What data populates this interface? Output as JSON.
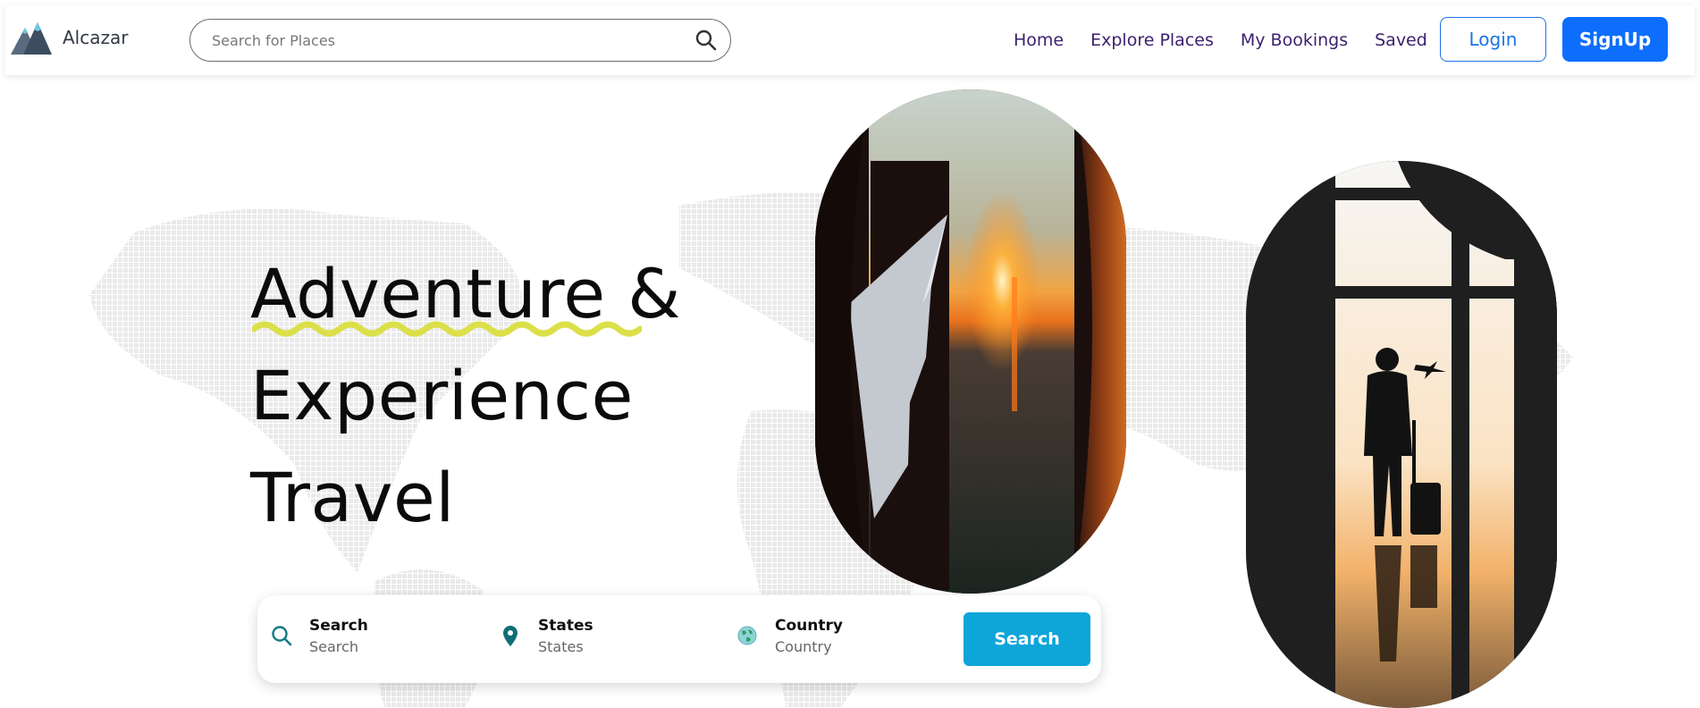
{
  "brand": {
    "name": "Alcazar",
    "logo_icon": "mountain-icon"
  },
  "header_search": {
    "placeholder": "Search for Places",
    "icon": "search-icon"
  },
  "nav": {
    "links": [
      "Home",
      "Explore Places",
      "My Bookings",
      "Saved"
    ],
    "login_label": "Login",
    "signup_label": "SignUp"
  },
  "hero": {
    "title_lines": [
      "Adventure &",
      "Experience",
      "Travel"
    ],
    "underline_color": "#dbe04a",
    "images": [
      {
        "icon": "airplane-window-sunset-image"
      },
      {
        "icon": "traveler-silhouette-image"
      }
    ]
  },
  "search_card": {
    "fields": [
      {
        "label": "Search",
        "value": "Search",
        "icon": "search-icon"
      },
      {
        "label": "States",
        "value": "States",
        "icon": "location-pin-icon"
      },
      {
        "label": "Country",
        "value": "Country",
        "icon": "globe-icon"
      }
    ],
    "button_label": "Search"
  },
  "colors": {
    "nav_link": "#3b1f6e",
    "primary_button": "#0d6efd",
    "login_border": "#1a73e8",
    "search_button": "#0ea5d9",
    "field_icon": "#0f7a84"
  }
}
